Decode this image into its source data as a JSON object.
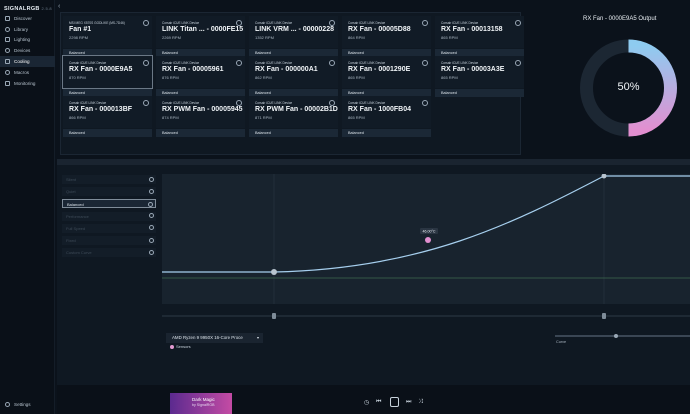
{
  "app": {
    "logo": "SIGNALRGB",
    "version": "2.5.8"
  },
  "sidebar": {
    "items": [
      {
        "label": "Discover",
        "icon": "compass-icon"
      },
      {
        "label": "Library",
        "icon": "library-icon"
      },
      {
        "label": "Lighting",
        "icon": "lightbulb-icon"
      },
      {
        "label": "Devices",
        "icon": "devices-icon"
      },
      {
        "label": "Cooling",
        "icon": "fan-icon",
        "active": true
      },
      {
        "label": "Macros",
        "icon": "macro-icon"
      },
      {
        "label": "Monitoring",
        "icon": "monitor-icon"
      }
    ],
    "settings_label": "Settings"
  },
  "fans": [
    {
      "device": "MSI MEG X570S GODLIKE (MS-7D46)",
      "name": "Fan #1",
      "rpm": "2298 RPM",
      "mode": "Balanced"
    },
    {
      "device": "Corsair iCUE LINK Device",
      "name": "LINK Titan ... - 0000FE15",
      "rpm": "2269 RPM",
      "mode": "Balanced"
    },
    {
      "device": "Corsair iCUE LINK Device",
      "name": "LINK VRM ... - 00000228",
      "rpm": "1352 RPM",
      "mode": "Balanced"
    },
    {
      "device": "Corsair iCUE LINK Device",
      "name": "RX Fan - 00005D88",
      "rpm": "864 RPM",
      "mode": "Balanced"
    },
    {
      "device": "Corsair iCUE LINK Device",
      "name": "RX Fan - 00013158",
      "rpm": "865 RPM",
      "mode": "Balanced"
    },
    {
      "device": "Corsair iCUE LINK Device",
      "name": "RX Fan - 0000E9A5",
      "rpm": "870 RPM",
      "mode": "Balanced",
      "selected": true
    },
    {
      "device": "Corsair iCUE LINK Device",
      "name": "RX Fan - 00005961",
      "rpm": "876 RPM",
      "mode": "Balanced"
    },
    {
      "device": "Corsair iCUE LINK Device",
      "name": "RX Fan - 000000A1",
      "rpm": "862 RPM",
      "mode": "Balanced"
    },
    {
      "device": "Corsair iCUE LINK Device",
      "name": "RX Fan - 0001290E",
      "rpm": "865 RPM",
      "mode": "Balanced"
    },
    {
      "device": "Corsair iCUE LINK Device",
      "name": "RX Fan - 00003A3E",
      "rpm": "865 RPM",
      "mode": "Balanced"
    },
    {
      "device": "Corsair iCUE LINK Device",
      "name": "RX Fan - 000013BF",
      "rpm": "866 RPM",
      "mode": "Balanced"
    },
    {
      "device": "Corsair iCUE LINK Device",
      "name": "RX PWM Fan - 00005945",
      "rpm": "874 RPM",
      "mode": "Balanced"
    },
    {
      "device": "Corsair iCUE LINK Device",
      "name": "RX PWM Fan - 00002B1D",
      "rpm": "871 RPM",
      "mode": "Balanced"
    },
    {
      "device": "Corsair iCUE LINK Device",
      "name": "RX Fan - 1000FB04",
      "rpm": "865 RPM",
      "mode": "Balanced"
    }
  ],
  "output": {
    "title": "RX Fan - 0000E9A5 Output",
    "percent_label": "50%",
    "percent": 50,
    "colors": {
      "track": "#1c2733",
      "gradient_start": "#8ecbf0",
      "gradient_end": "#e28fd0"
    }
  },
  "modes": [
    {
      "label": "Silent"
    },
    {
      "label": "Quiet"
    },
    {
      "label": "Balanced",
      "active": true
    },
    {
      "label": "Performance"
    },
    {
      "label": "Full Speed"
    },
    {
      "label": "Fixed"
    },
    {
      "label": "Custom Curve"
    }
  ],
  "curve": {
    "marker_label": "46.00°C",
    "sensor_select": "AMD Ryzen 9 9950X 16-Core Proce",
    "sensors_label": "Sensors",
    "curve_label": "Curve"
  },
  "player": {
    "song": "Dark Magic",
    "artist": "by SignalRGB"
  }
}
